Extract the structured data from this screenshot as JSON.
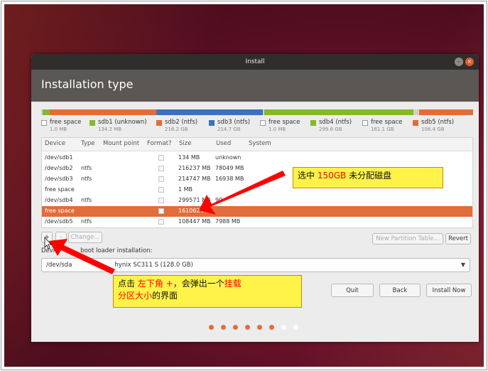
{
  "window": {
    "title": "Install",
    "minimize_glyph": "–",
    "close_glyph": "×"
  },
  "page": {
    "title": "Installation type"
  },
  "partition_bar": [
    {
      "color": "#cfcfcf"
    },
    {
      "color": "#86b82b"
    },
    {
      "color": "#e16d3a"
    },
    {
      "color": "#3b73b9"
    },
    {
      "color": "#cfcfcf"
    },
    {
      "color": "#86b82b"
    },
    {
      "color": "#cfcfcf"
    },
    {
      "color": "#e16d3a"
    }
  ],
  "legend": [
    {
      "name": "free space",
      "size": "1.0 MB",
      "color": "#ffffff"
    },
    {
      "name": "sdb1 (unknown)",
      "size": "134.2 MB",
      "color": "#86b82b"
    },
    {
      "name": "sdb2 (ntfs)",
      "size": "216.2 GB",
      "color": "#e16d3a"
    },
    {
      "name": "sdb3 (ntfs)",
      "size": "214.7 GB",
      "color": "#3b73b9"
    },
    {
      "name": "free space",
      "size": "1.0 MB",
      "color": "#ffffff"
    },
    {
      "name": "sdb4 (ntfs)",
      "size": "299.6 GB",
      "color": "#86b82b"
    },
    {
      "name": "free space",
      "size": "161.1 GB",
      "color": "#ffffff"
    },
    {
      "name": "sdb5 (ntfs)",
      "size": "108.4 GB",
      "color": "#e16d3a"
    }
  ],
  "table": {
    "columns": [
      "Device",
      "Type",
      "Mount point",
      "Format?",
      "Size",
      "Used",
      "System"
    ],
    "rows": [
      {
        "device": "/dev/sdb1",
        "type": "",
        "size": "134 MB",
        "used": "unknown"
      },
      {
        "device": "/dev/sdb2",
        "type": "ntfs",
        "size": "216237 MB",
        "used": "78049 MB"
      },
      {
        "device": "/dev/sdb3",
        "type": "ntfs",
        "size": "214747 MB",
        "used": "16938 MB"
      },
      {
        "device": "free space",
        "type": "",
        "size": "1 MB",
        "used": ""
      },
      {
        "device": "/dev/sdb4",
        "type": "ntfs",
        "size": "299571 MB",
        "used": "90"
      },
      {
        "device": "free space",
        "type": "",
        "size": "161062 MB",
        "used": ""
      },
      {
        "device": "/dev/sdb5",
        "type": "ntfs",
        "size": "108447 MB",
        "used": "7988 MB"
      }
    ]
  },
  "buttons": {
    "add": "+",
    "remove": "–",
    "change": "Change...",
    "new_table": "New Partition Table...",
    "revert": "Revert",
    "quit": "Quit",
    "back": "Back",
    "install": "Install Now"
  },
  "bootloader": {
    "label_a": "Devi",
    "label_b": "boot loader installation:",
    "value_a": "/dev/sda",
    "value_b": "hynix SC311 S (128.0 GB)"
  },
  "progress_dots": [
    {
      "color": "#e16d3a"
    },
    {
      "color": "#e16d3a"
    },
    {
      "color": "#e16d3a"
    },
    {
      "color": "#e16d3a"
    },
    {
      "color": "#e16d3a"
    },
    {
      "color": "#e16d3a"
    },
    {
      "color": "#ffffff"
    },
    {
      "color": "#ffffff"
    }
  ],
  "annotations": {
    "top": {
      "pre": "选中 ",
      "hl": "150GB",
      "post": " 未分配磁盘"
    },
    "bottom": {
      "line1_a": "点击 ",
      "line1_hl1": "左下角 +",
      "line1_b": "，会弹出一个",
      "line1_hl2": "挂载",
      "line2_hl": "分区大小",
      "line2_b": "的界面"
    }
  },
  "colors": {
    "accent": "#e16d3a",
    "annotation_arrow": "#ff0000",
    "callout_bg": "#fff34a"
  }
}
